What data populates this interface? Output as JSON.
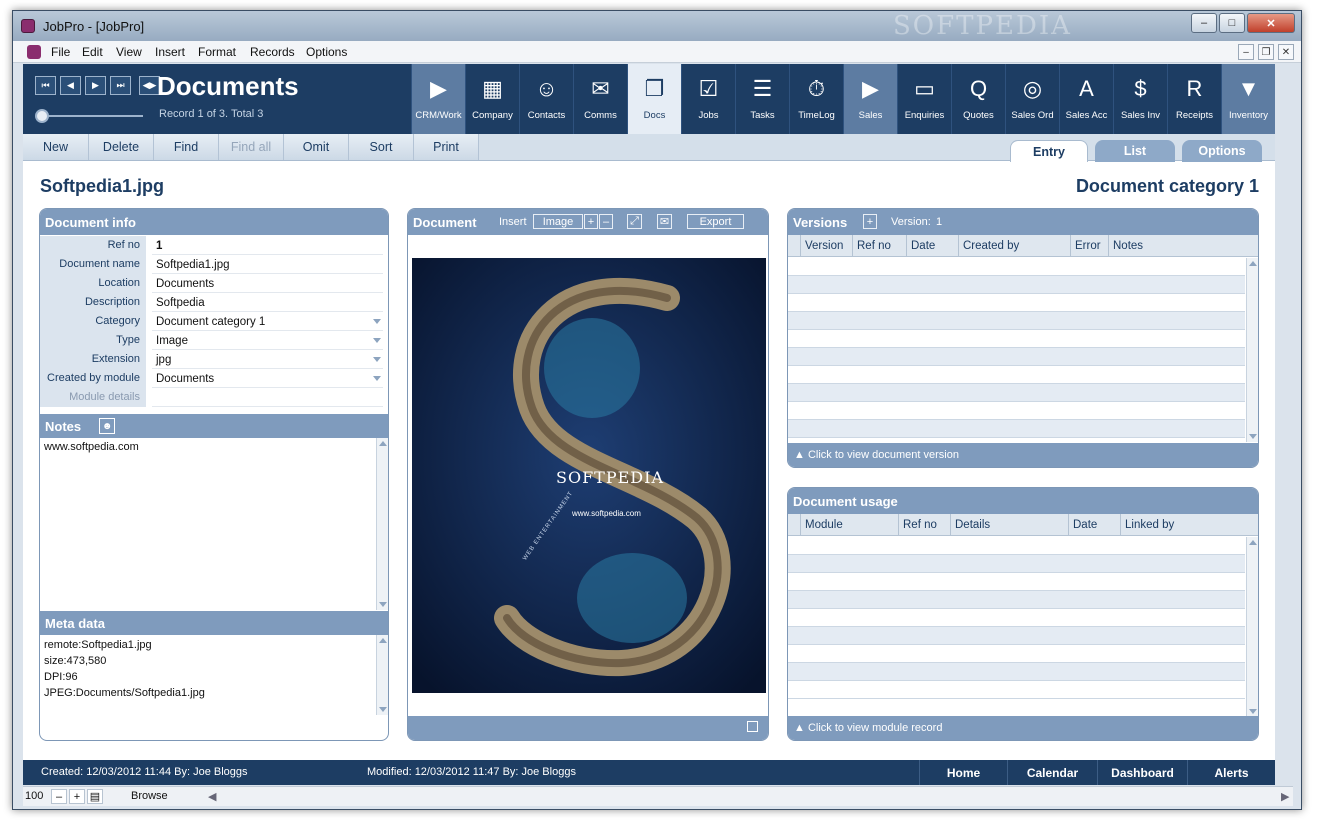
{
  "window": {
    "title": "JobPro - [JobPro]",
    "watermark": "SOFTPEDIA"
  },
  "menu": [
    "File",
    "Edit",
    "View",
    "Insert",
    "Format",
    "Records",
    "Options"
  ],
  "header": {
    "title": "Documents",
    "record_status": "Record 1 of 3. Total 3",
    "nav": [
      "⏮",
      "◀",
      "▶",
      "⏭",
      "◀▶"
    ]
  },
  "modules": [
    {
      "label": "CRM/Work",
      "icon": "chevron-right-icon",
      "glyph": "▶"
    },
    {
      "label": "Company",
      "icon": "building-icon",
      "glyph": "▦"
    },
    {
      "label": "Contacts",
      "icon": "person-icon",
      "glyph": "☺"
    },
    {
      "label": "Comms",
      "icon": "envelope-icon",
      "glyph": "✉"
    },
    {
      "label": "Docs",
      "icon": "documents-icon",
      "glyph": "❐"
    },
    {
      "label": "Jobs",
      "icon": "briefcase-icon",
      "glyph": "☑"
    },
    {
      "label": "Tasks",
      "icon": "checklist-icon",
      "glyph": "☰"
    },
    {
      "label": "TimeLog",
      "icon": "stopwatch-icon",
      "glyph": "⏱"
    },
    {
      "label": "Sales",
      "icon": "chevron-right-icon",
      "glyph": "▶"
    },
    {
      "label": "Enquiries",
      "icon": "folder-icon",
      "glyph": "▭"
    },
    {
      "label": "Quotes",
      "icon": "quote-icon",
      "glyph": "Q"
    },
    {
      "label": "Sales Ord",
      "icon": "disc-icon",
      "glyph": "◎"
    },
    {
      "label": "Sales Acc",
      "icon": "account-icon",
      "glyph": "A"
    },
    {
      "label": "Sales Inv",
      "icon": "invoice-icon",
      "glyph": "$"
    },
    {
      "label": "Receipts",
      "icon": "receipt-icon",
      "glyph": "R"
    },
    {
      "label": "Inventory",
      "icon": "chevron-down-icon",
      "glyph": "▼"
    }
  ],
  "toolbar": [
    "New",
    "Delete",
    "Find",
    "Find all",
    "Omit",
    "Sort",
    "Print"
  ],
  "tabs": [
    "Entry",
    "List",
    "Options"
  ],
  "record": {
    "name": "Softpedia1.jpg",
    "category_title": "Document category 1"
  },
  "document_info": {
    "heading": "Document info",
    "fields": [
      {
        "label": "Ref no",
        "value": "1"
      },
      {
        "label": "Document name",
        "value": "Softpedia1.jpg"
      },
      {
        "label": "Location",
        "value": "Documents"
      },
      {
        "label": "Description",
        "value": "Softpedia"
      },
      {
        "label": "Category",
        "value": "Document category 1"
      },
      {
        "label": "Type",
        "value": "Image"
      },
      {
        "label": "Extension",
        "value": "jpg"
      },
      {
        "label": "Created by module",
        "value": "Documents"
      },
      {
        "label": "Module details",
        "value": ""
      }
    ]
  },
  "notes": {
    "heading": "Notes",
    "text": "www.softpedia.com"
  },
  "meta": {
    "heading": "Meta data",
    "lines": [
      "remote:Softpedia1.jpg",
      "size:473,580",
      "DPI:96",
      "JPEG:Documents/Softpedia1.jpg"
    ]
  },
  "document_panel": {
    "heading": "Document",
    "insert_label": "Insert",
    "image_label": "Image",
    "export_label": "Export",
    "image_text": "SOFTPEDIA",
    "image_url": "www.softpedia.com",
    "image_caption": "WEB ENTERTAINMENT"
  },
  "versions": {
    "heading": "Versions",
    "version_label": "Version:",
    "version_value": "1",
    "columns": [
      "Version",
      "Ref no",
      "Date",
      "Created by",
      "Error",
      "Notes"
    ],
    "footer": "Click to view document version"
  },
  "usage": {
    "heading": "Document usage",
    "columns": [
      "Module",
      "Ref no",
      "Details",
      "Date",
      "Linked by"
    ],
    "footer": "Click to view module record"
  },
  "status": {
    "created": "Created: 12/03/2012  11:44   By: Joe Bloggs",
    "modified": "Modified: 12/03/2012  11:47   By: Joe Bloggs",
    "buttons": [
      "Home",
      "Calendar",
      "Dashboard",
      "Alerts"
    ]
  },
  "bottom": {
    "zoom": "100",
    "mode": "Browse"
  }
}
